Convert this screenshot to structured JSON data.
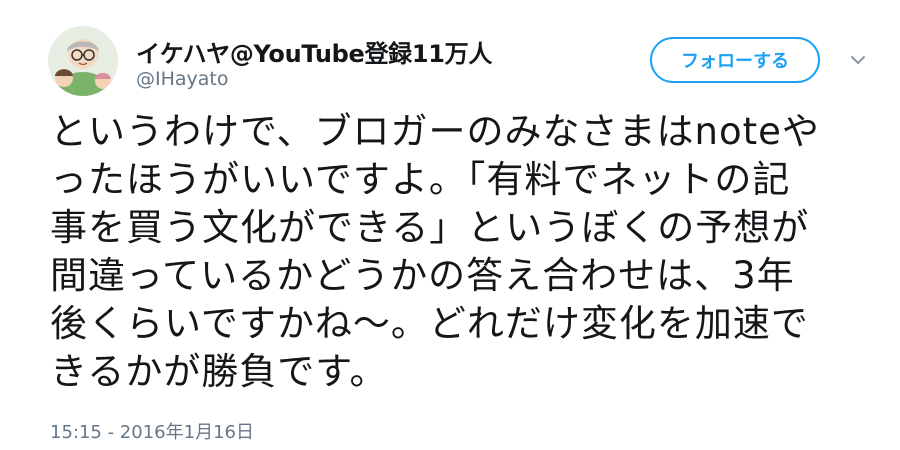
{
  "tweet": {
    "author": {
      "display_name": "イケハヤ@YouTube登録11万人",
      "handle": "@IHayato"
    },
    "follow_button_label": "フォローする",
    "text_lines": [
      "というわけで、ブロガーのみなさまはnoteや",
      "ったほうがいいですよ。「有料でネットの記",
      "事を買う文化ができる」というぼくの予想が",
      "間違っているかどうかの答え合わせは、3年",
      "後くらいですかね〜。どれだけ変化を加速で",
      "きるかが勝負です。"
    ],
    "timestamp": "15:15 - 2016年1月16日"
  },
  "colors": {
    "accent": "#1da1f2",
    "text_primary": "#14171a",
    "text_secondary": "#657786"
  },
  "icons": {
    "caret": "chevron-down-icon",
    "avatar": "avatar"
  }
}
